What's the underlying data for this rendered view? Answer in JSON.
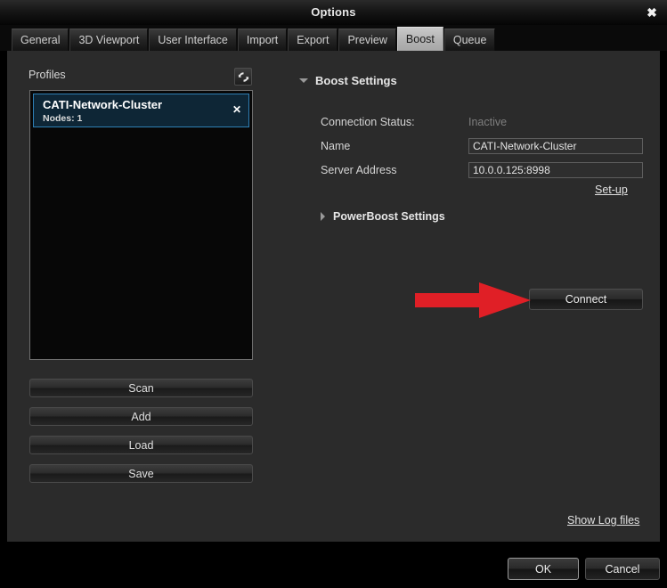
{
  "window": {
    "title": "Options",
    "close_label": "✖"
  },
  "tabs": [
    {
      "label": "General",
      "active": false
    },
    {
      "label": "3D Viewport",
      "active": false
    },
    {
      "label": "User Interface",
      "active": false
    },
    {
      "label": "Import",
      "active": false
    },
    {
      "label": "Export",
      "active": false
    },
    {
      "label": "Preview",
      "active": false
    },
    {
      "label": "Boost",
      "active": true
    },
    {
      "label": "Queue",
      "active": false
    }
  ],
  "profiles_panel": {
    "label": "Profiles",
    "refresh_icon": "refresh-icon",
    "items": [
      {
        "name": "CATI-Network-Cluster",
        "nodes": "Nodes: 1",
        "remove_label": "✕",
        "selected": true
      }
    ],
    "buttons": [
      {
        "label": "Scan"
      },
      {
        "label": "Add"
      },
      {
        "label": "Load"
      },
      {
        "label": "Save"
      }
    ]
  },
  "boost_settings": {
    "section_title": "Boost Settings",
    "expanded": true,
    "connection_status_label": "Connection Status:",
    "connection_status_value": "Inactive",
    "name_label": "Name",
    "name_value": "CATI-Network-Cluster",
    "name_placeholder": "",
    "server_address_label": "Server Address",
    "server_address_value": "10.0.0.125:8998",
    "server_address_placeholder": "",
    "setup_link": "Set-up",
    "powerboost_title": "PowerBoost Settings",
    "powerboost_expanded": false,
    "connect_label": "Connect"
  },
  "footer": {
    "show_log_files": "Show Log files",
    "ok_label": "OK",
    "cancel_label": "Cancel"
  },
  "annotation": {
    "type": "arrow",
    "color": "#e01f26",
    "points_to": "Connect"
  },
  "colors": {
    "dialog_bg": "#2b2b2b",
    "titlebar_bg": "#161616",
    "list_bg": "#070707",
    "selection_bg": "#0e2636",
    "selection_border": "#2e7fb5",
    "accent_red": "#e01f26",
    "active_tab_bg": "#b3b3b3"
  }
}
